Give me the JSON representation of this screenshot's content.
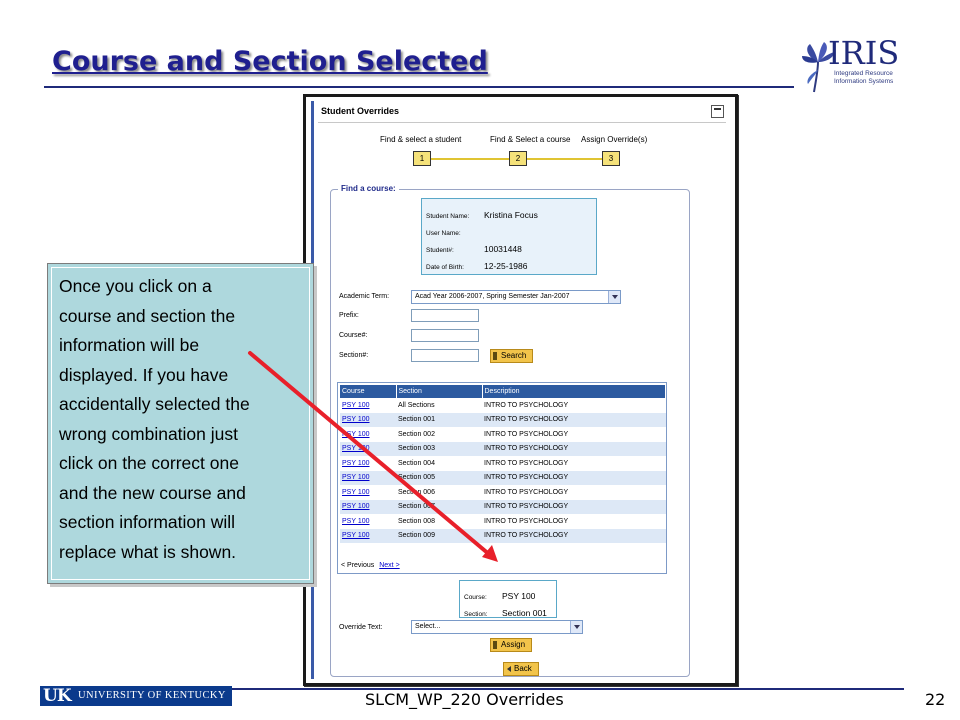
{
  "slide": {
    "title": "Course and Section Selected",
    "footer": "SLCM_WP_220 Overrides",
    "page_number": "22"
  },
  "logos": {
    "iris_word": "IRIS",
    "iris_subtitle": "Integrated Resource Information Systems",
    "uk_mark": "UK",
    "uk_name": "UNIVERSITY OF KENTUCKY"
  },
  "panel": {
    "title": "Student Overrides",
    "steps": [
      {
        "label": "Find & select a student",
        "number": "1"
      },
      {
        "label": "Find & Select a course",
        "number": "2"
      },
      {
        "label": "Assign Override(s)",
        "number": "3"
      }
    ],
    "find_course_legend": "Find a course:",
    "student": {
      "name_label": "Student Name:",
      "name_value": "Kristina Focus",
      "user_label": "User Name:",
      "user_value": "",
      "number_label": "Student#:",
      "number_value": "10031448",
      "dob_label": "Date of Birth:",
      "dob_value": "12-25-1986"
    },
    "form": {
      "term_label": "Academic Term:",
      "term_value": "Acad Year 2006-2007, Spring Semester Jan-2007",
      "prefix_label": "Prefix:",
      "course_label": "Course#:",
      "section_label": "Section#:",
      "search_button": "Search"
    },
    "table": {
      "headers": [
        "Course",
        "Section",
        "Description"
      ],
      "rows": [
        [
          "PSY 100",
          "All Sections",
          "INTRO TO PSYCHOLOGY"
        ],
        [
          "PSY 100",
          "Section 001",
          "INTRO TO PSYCHOLOGY"
        ],
        [
          "PSY 100",
          "Section 002",
          "INTRO TO PSYCHOLOGY"
        ],
        [
          "PSY 100",
          "Section 003",
          "INTRO TO PSYCHOLOGY"
        ],
        [
          "PSY 100",
          "Section 004",
          "INTRO TO PSYCHOLOGY"
        ],
        [
          "PSY 100",
          "Section 005",
          "INTRO TO PSYCHOLOGY"
        ],
        [
          "PSY 100",
          "Section 006",
          "INTRO TO PSYCHOLOGY"
        ],
        [
          "PSY 100",
          "Section 007",
          "INTRO TO PSYCHOLOGY"
        ],
        [
          "PSY 100",
          "Section 008",
          "INTRO TO PSYCHOLOGY"
        ],
        [
          "PSY 100",
          "Section 009",
          "INTRO TO PSYCHOLOGY"
        ]
      ],
      "prev_label": "< Previous",
      "next_label": "Next >"
    },
    "selected": {
      "course_label": "Course:",
      "course_value": "PSY 100",
      "section_label": "Section:",
      "section_value": "Section 001"
    },
    "override_label": "Override Text:",
    "override_value": "Select...",
    "assign_button": "Assign",
    "back_button": "Back"
  },
  "callout": {
    "lines": [
      "Once you click on a",
      "course and section the",
      "information will be",
      "displayed. If you have",
      "accidentally selected the",
      "wrong combination just",
      "click on the correct one",
      "and the new course and",
      "section information will",
      "replace what is shown."
    ]
  },
  "colors": {
    "title": "#1f1f8f",
    "callout_bg": "#aed8dd",
    "arrow": "#e8202a",
    "table_header": "#2c5aa0",
    "button": "#f2c44a"
  }
}
